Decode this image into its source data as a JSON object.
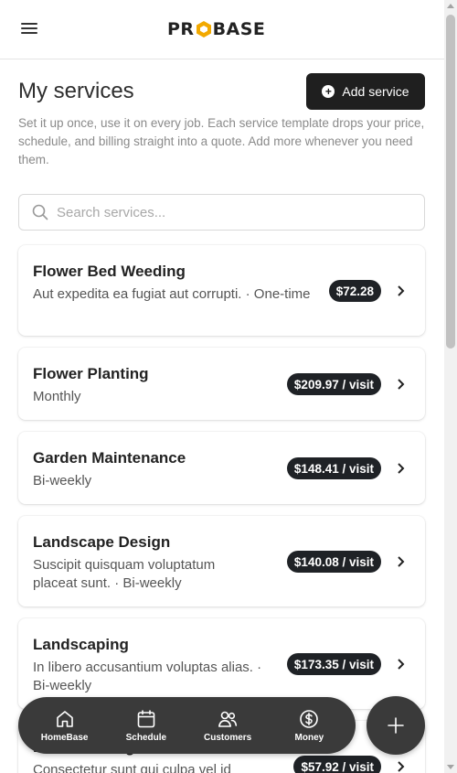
{
  "header": {
    "logo_text_left": "PR",
    "logo_text_right": "BASE"
  },
  "page": {
    "title": "My services",
    "add_button_label": "Add service",
    "intro": "Set it up once, use it on every job. Each service template drops your price, schedule, and billing straight into a quote. Add more whenever you need them."
  },
  "search": {
    "placeholder": "Search services..."
  },
  "services": [
    {
      "name": "Flower Bed Weeding",
      "desc": "Aut expedita ea fugiat aut corrupti. · One-time",
      "price": "$72.28"
    },
    {
      "name": "Flower Planting",
      "desc": "Monthly",
      "price": "$209.97 / visit"
    },
    {
      "name": "Garden Maintenance",
      "desc": "Bi-weekly",
      "price": "$148.41 / visit"
    },
    {
      "name": "Landscape Design",
      "desc": "Suscipit quisquam voluptatum placeat sunt. · Bi-weekly",
      "price": "$140.08 / visit"
    },
    {
      "name": "Landscaping",
      "desc": "In libero accusantium voluptas alias. · Bi-weekly",
      "price": "$173.35 / visit"
    },
    {
      "name": "Lawn Mowing",
      "desc": "Consectetur sunt qui culpa vel id",
      "price": "$57.92 / visit"
    }
  ],
  "nav": {
    "items": [
      {
        "label": "HomeBase",
        "icon": "home-icon"
      },
      {
        "label": "Schedule",
        "icon": "calendar-icon"
      },
      {
        "label": "Customers",
        "icon": "users-icon"
      },
      {
        "label": "Money",
        "icon": "dollar-icon"
      }
    ],
    "fab_icon": "plus-icon"
  },
  "colors": {
    "accent_dark": "#1f1f1f",
    "nav_bg": "#3a3a3a",
    "logo_accent": "#f2a900",
    "price_badge": "#1f2226"
  }
}
